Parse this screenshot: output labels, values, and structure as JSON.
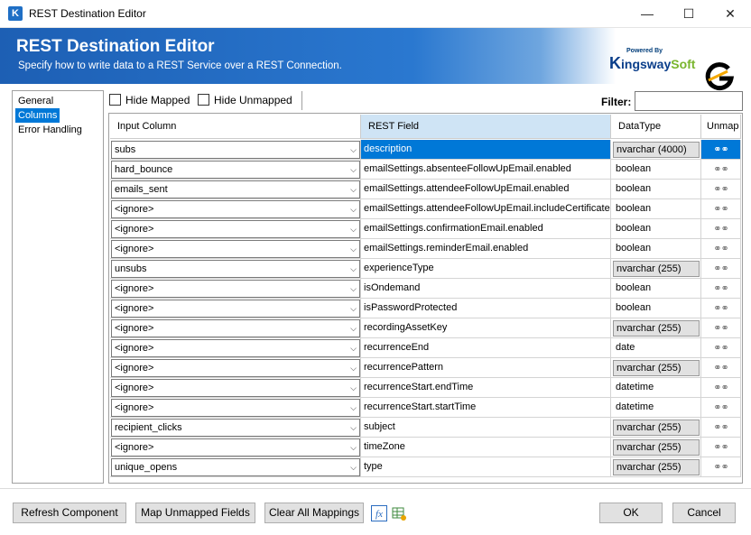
{
  "window": {
    "title": "REST Destination Editor",
    "minimize": "—",
    "maximize": "☐",
    "close": "✕",
    "app_icon_letter": "K"
  },
  "banner": {
    "title": "REST Destination Editor",
    "subtitle": "Specify how to write data to a REST Service over a REST Connection.",
    "brand_powered": "Powered By",
    "brand_k": "K",
    "brand_ingsway": "ingsway",
    "brand_soft": "Soft",
    "logo_letter": "G"
  },
  "nav": {
    "items": [
      "General",
      "Columns",
      "Error Handling"
    ],
    "selected": "Columns"
  },
  "toolbar": {
    "hide_mapped": "Hide Mapped",
    "hide_unmapped": "Hide Unmapped",
    "filter_label": "Filter:",
    "filter_value": ""
  },
  "grid": {
    "headers": [
      "Input Column",
      "REST Field",
      "DataType",
      "Unmap"
    ],
    "rows": [
      {
        "input": "subs",
        "field": "description",
        "type": "nvarchar (4000)",
        "boxed": true,
        "selected": true
      },
      {
        "input": "hard_bounce",
        "field": "emailSettings.absenteeFollowUpEmail.enabled",
        "type": "boolean",
        "boxed": false
      },
      {
        "input": "emails_sent",
        "field": "emailSettings.attendeeFollowUpEmail.enabled",
        "type": "boolean",
        "boxed": false
      },
      {
        "input": "<ignore>",
        "field": "emailSettings.attendeeFollowUpEmail.includeCertificate",
        "type": "boolean",
        "boxed": false
      },
      {
        "input": "<ignore>",
        "field": "emailSettings.confirmationEmail.enabled",
        "type": "boolean",
        "boxed": false
      },
      {
        "input": "<ignore>",
        "field": "emailSettings.reminderEmail.enabled",
        "type": "boolean",
        "boxed": false
      },
      {
        "input": "unsubs",
        "field": "experienceType",
        "type": "nvarchar (255)",
        "boxed": true
      },
      {
        "input": "<ignore>",
        "field": "isOndemand",
        "type": "boolean",
        "boxed": false
      },
      {
        "input": "<ignore>",
        "field": "isPasswordProtected",
        "type": "boolean",
        "boxed": false
      },
      {
        "input": "<ignore>",
        "field": "recordingAssetKey",
        "type": "nvarchar (255)",
        "boxed": true
      },
      {
        "input": "<ignore>",
        "field": "recurrenceEnd",
        "type": "date",
        "boxed": false
      },
      {
        "input": "<ignore>",
        "field": "recurrencePattern",
        "type": "nvarchar (255)",
        "boxed": true
      },
      {
        "input": "<ignore>",
        "field": "recurrenceStart.endTime",
        "type": "datetime",
        "boxed": false
      },
      {
        "input": "<ignore>",
        "field": "recurrenceStart.startTime",
        "type": "datetime",
        "boxed": false
      },
      {
        "input": "recipient_clicks",
        "field": "subject",
        "type": "nvarchar (255)",
        "boxed": true
      },
      {
        "input": "<ignore>",
        "field": "timeZone",
        "type": "nvarchar (255)",
        "boxed": true
      },
      {
        "input": "unique_opens",
        "field": "type",
        "type": "nvarchar (255)",
        "boxed": true
      }
    ]
  },
  "buttons": {
    "refresh": "Refresh Component",
    "map_unmapped": "Map Unmapped Fields",
    "clear_all": "Clear All Mappings",
    "fx_icon_label": "fx",
    "ok": "OK",
    "cancel": "Cancel"
  }
}
